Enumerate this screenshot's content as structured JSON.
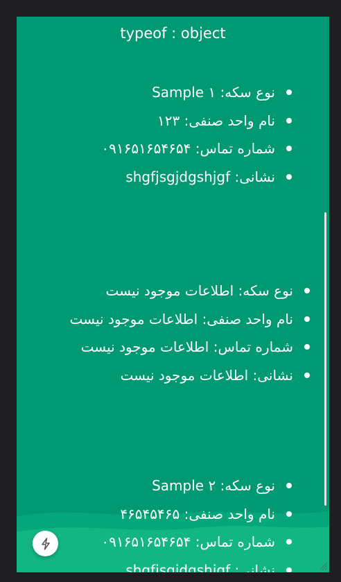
{
  "header": {
    "title": "typeof : object"
  },
  "cards": [
    {
      "items": [
        {
          "label": "نوع سکه:",
          "value": "Sample ۱"
        },
        {
          "label": "نام واحد صنفی:",
          "value": "۱۲۳"
        },
        {
          "label": "شماره تماس:",
          "value": "۰۹۱۶۵۱۶۵۴۶۵۴"
        },
        {
          "label": "نشانی:",
          "value": "shgfjsgjdgshjgf"
        }
      ]
    },
    {
      "items": [
        {
          "label": "نوع سکه:",
          "value": "اطلاعات موجود نیست"
        },
        {
          "label": "نام واحد صنفی:",
          "value": "اطلاعات موجود نیست"
        },
        {
          "label": "شماره تماس:",
          "value": "اطلاعات موجود نیست"
        },
        {
          "label": "نشانی:",
          "value": "اطلاعات موجود نیست"
        }
      ]
    },
    {
      "items": [
        {
          "label": "نوع سکه:",
          "value": "Sample ۲"
        },
        {
          "label": "نام واحد صنفی:",
          "value": "۴۶۵۴۵۴۶۵"
        },
        {
          "label": "شماره تماس:",
          "value": "۰۹۱۶۵۱۶۵۴۶۵۴"
        },
        {
          "label": "نشانی:",
          "value": "shgfjsgjdgshjgf"
        }
      ]
    }
  ],
  "fab": {
    "icon": "lightning-icon"
  },
  "colors": {
    "background": "#009974",
    "frame": "#1e1e20",
    "text": "#ffffff"
  }
}
